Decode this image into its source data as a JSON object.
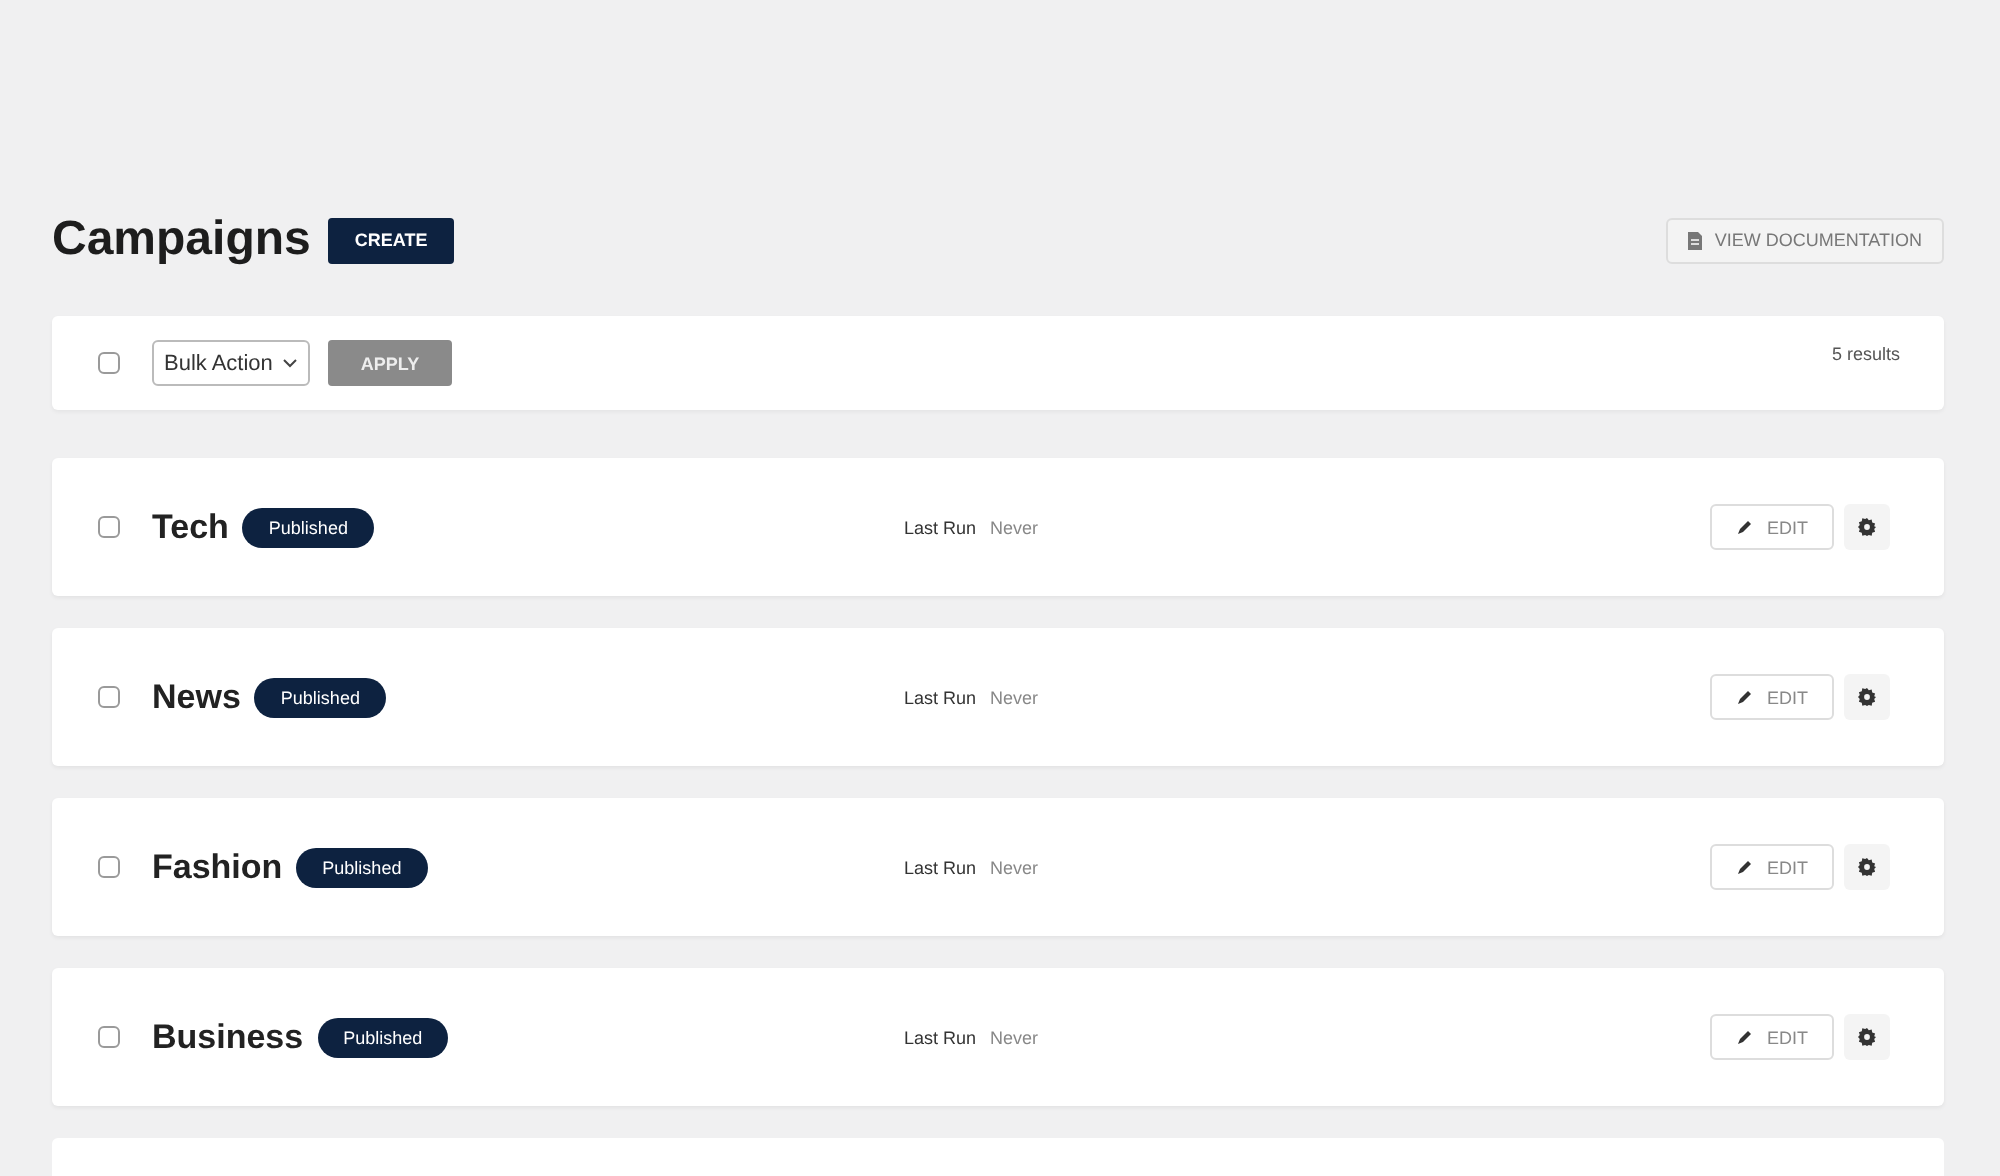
{
  "header": {
    "title": "Campaigns",
    "create_button": "CREATE",
    "docs_button": "VIEW DOCUMENTATION"
  },
  "toolbar": {
    "select_all": {
      "checked": false
    },
    "bulk_action": "Bulk Action",
    "apply_button": "APPLY",
    "results": "5 results"
  },
  "campaigns": [
    {
      "name": "Tech",
      "status": "Published",
      "checked": false,
      "last_run_label": "Last Run",
      "last_run": "Never",
      "edit_button": "EDIT"
    },
    {
      "name": "News",
      "status": "Published",
      "checked": false,
      "last_run_label": "Last Run",
      "last_run": "Never",
      "edit_button": "EDIT"
    },
    {
      "name": "Fashion",
      "status": "Published",
      "checked": false,
      "last_run_label": "Last Run",
      "last_run": "Never",
      "edit_button": "EDIT"
    },
    {
      "name": "Business",
      "status": "Published",
      "checked": false,
      "last_run_label": "Last Run",
      "last_run": "Never",
      "edit_button": "EDIT"
    }
  ]
}
